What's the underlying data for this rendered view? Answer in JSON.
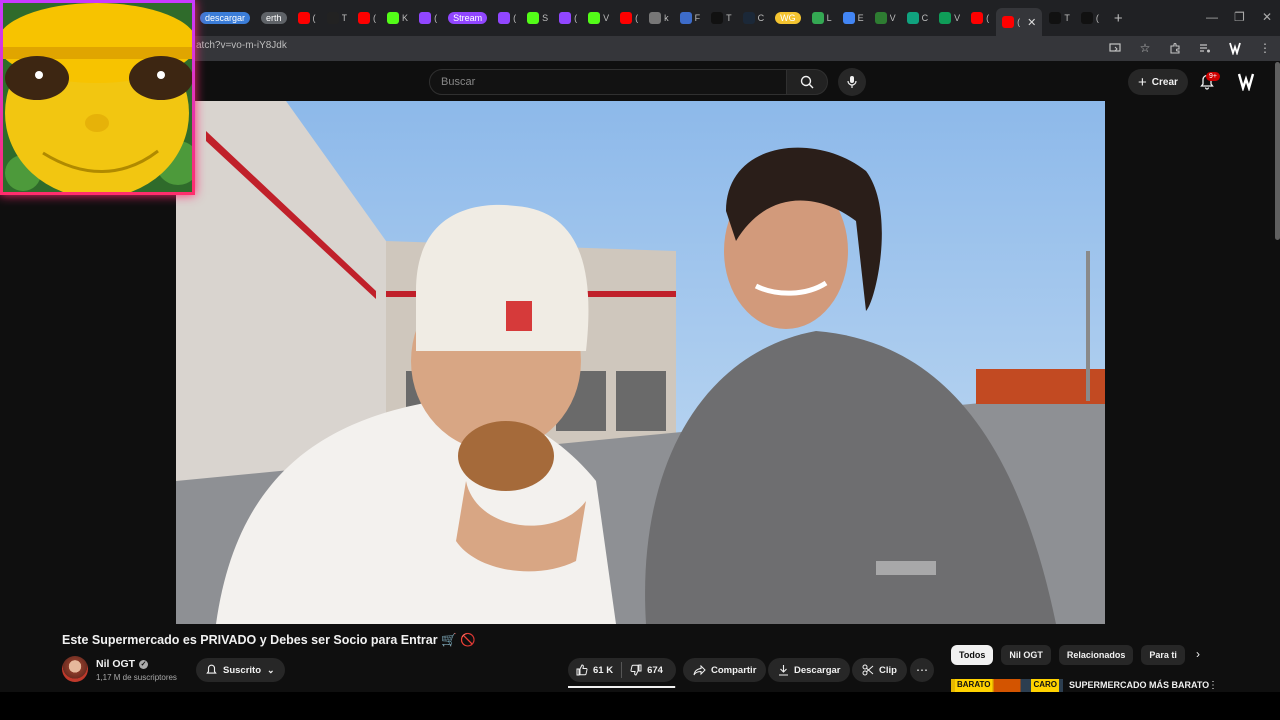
{
  "browser": {
    "tabs": [
      {
        "label": "descargar",
        "pill": true,
        "color": "#3b7dd8"
      },
      {
        "label": "erth",
        "pill": true,
        "color": "#5f6368"
      },
      {
        "label": "(",
        "color": "#ff0000"
      },
      {
        "label": "T",
        "color": "#222222"
      },
      {
        "label": "(",
        "color": "#ff0000"
      },
      {
        "label": "K",
        "color": "#53fc18"
      },
      {
        "label": "(",
        "color": "#9146ff"
      },
      {
        "label": "Stream",
        "pill": true,
        "color": "#9146ff"
      },
      {
        "label": "(",
        "color": "#9146ff"
      },
      {
        "label": "S",
        "color": "#53fc18"
      },
      {
        "label": "(",
        "color": "#9146ff"
      },
      {
        "label": "V",
        "color": "#53fc18"
      },
      {
        "label": "(",
        "color": "#ff0000"
      },
      {
        "label": "k",
        "color": "#777777"
      },
      {
        "label": "F",
        "color": "#3d6cc9"
      },
      {
        "label": "T",
        "color": "#111111"
      },
      {
        "label": "C",
        "color": "#1b2838"
      },
      {
        "label": "WG",
        "pill": true,
        "color": "#f4c430"
      },
      {
        "label": "L",
        "color": "#34a853"
      },
      {
        "label": "E",
        "color": "#4285f4"
      },
      {
        "label": "V",
        "color": "#2e7d32"
      },
      {
        "label": "C",
        "color": "#10a37f"
      },
      {
        "label": "V",
        "color": "#0f9d58"
      },
      {
        "label": "(",
        "color": "#ff0000"
      }
    ],
    "active_tab": {
      "label": "(",
      "close": "✕"
    },
    "after_tabs": [
      {
        "label": "T",
        "color": "#111111"
      },
      {
        "label": "(",
        "color": "#111111"
      }
    ],
    "new_tab": "+",
    "url": "atch?v=vo-m-iY8Jdk"
  },
  "youtube": {
    "search_placeholder": "Buscar",
    "create_label": "Crear",
    "notification_count": "9+"
  },
  "video": {
    "title": "Este Supermercado es PRIVADO y Debes ser Socio para Entrar 🛒 🚫",
    "channel": {
      "name": "Nil OGT",
      "subscribers": "1,17 M de suscriptores"
    },
    "subscribe_label": "Suscrito",
    "likes": "61 K",
    "dislikes": "674",
    "like_ratio": 0.989,
    "share_label": "Compartir",
    "download_label": "Descargar",
    "clip_label": "Clip"
  },
  "sidebar": {
    "chips": [
      "Todos",
      "Nil OGT",
      "Relacionados",
      "Para ti"
    ],
    "selected_chip": "Todos",
    "recommendation": {
      "title": "SUPERMERCADO MÁS BARATO",
      "thumb_left": "BARATO",
      "thumb_right": "CARO"
    }
  },
  "colors": {
    "accent": "#ff0000",
    "background": "#0f0f0f",
    "webcam_border": "#ff2e6d"
  }
}
